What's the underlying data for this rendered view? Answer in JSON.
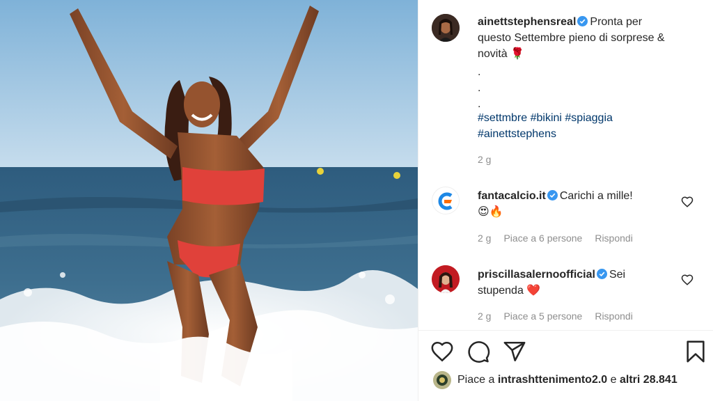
{
  "post": {
    "author": "ainettstephensreal",
    "caption_line1": "Pronta per",
    "caption_line2": "questo Settembre pieno di sorprese &",
    "caption_line3": "novità 🌹",
    "dot1": ".",
    "dot2": ".",
    "dot3": ".",
    "hashtags_line1": [
      "#settmbre",
      "#bikini",
      "#spiaggia"
    ],
    "hashtags_line2": [
      "#ainettstephens"
    ],
    "time": "2 g"
  },
  "comments": [
    {
      "user": "fantacalcio.it",
      "text": "Carichi a mille!",
      "emoji": "😍🔥",
      "time": "2 g",
      "likes": "Piace a 6 persone",
      "reply": "Rispondi"
    },
    {
      "user": "priscillasalernoofficial",
      "text": "Sei",
      "text2": "stupenda",
      "emoji": "❤️",
      "time": "2 g",
      "likes": "Piace a 5 persone",
      "reply": "Rispondi"
    }
  ],
  "likes": {
    "prefix": "Piace a",
    "user": "intrashttenimento2.0",
    "middle": "e",
    "others": "altri 28.841"
  },
  "icons": {
    "verified": "verified-badge-icon",
    "heart": "heart-icon",
    "comment": "comment-icon",
    "share": "share-icon",
    "bookmark": "bookmark-icon"
  },
  "colors": {
    "verified": "#3897f0",
    "hashtag": "#00376b",
    "meta": "#8e8e8e",
    "fantacalcio_blue": "#1e88e5",
    "fantacalcio_orange": "#ff6d00"
  }
}
